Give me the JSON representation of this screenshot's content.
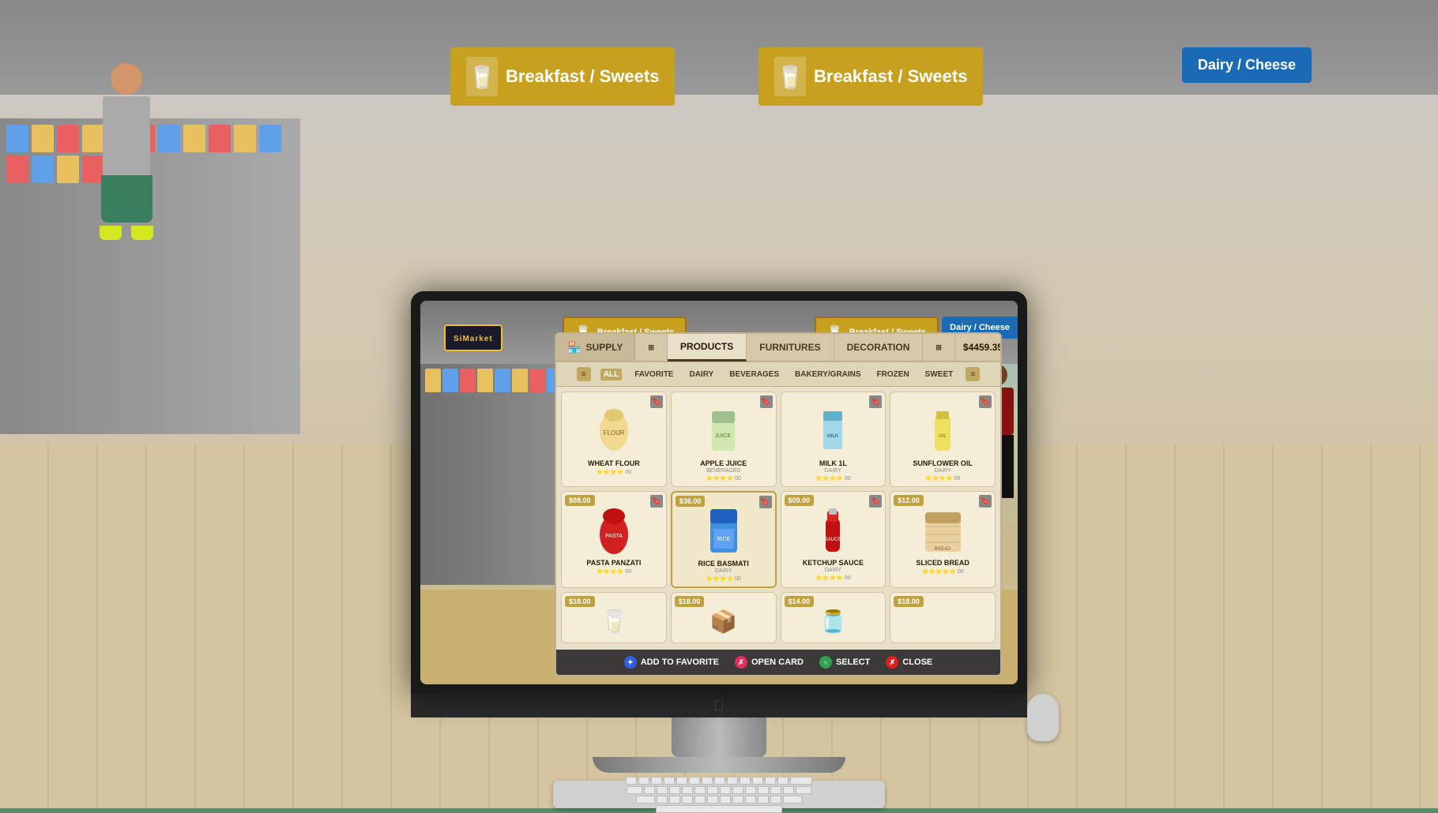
{
  "app": {
    "title": "SiMarket"
  },
  "header": {
    "supply_label": "SUPPLY",
    "nav_tabs": [
      {
        "id": "products",
        "label": "PRODUCTS",
        "active": true
      },
      {
        "id": "furnitures",
        "label": "FURNITURES",
        "active": false
      },
      {
        "id": "decoration",
        "label": "DECORATION",
        "active": false
      }
    ],
    "balance": "$4459.35"
  },
  "filters": {
    "items": [
      {
        "id": "all",
        "label": "ALL",
        "active": true
      },
      {
        "id": "favorite",
        "label": "FAVORITE",
        "active": false
      },
      {
        "id": "dairy",
        "label": "DAIRY",
        "active": false
      },
      {
        "id": "beverages",
        "label": "BEVERAGES",
        "active": false
      },
      {
        "id": "bakery_grains",
        "label": "BAKERY/GRAINS",
        "active": false
      },
      {
        "id": "frozen",
        "label": "FROZEN",
        "active": false
      },
      {
        "id": "sweet",
        "label": "SWEET",
        "active": false
      }
    ]
  },
  "products": {
    "row1": [
      {
        "id": "wheat_flour",
        "name": "WHEAT FLOUR",
        "price": "",
        "sub": "",
        "emoji": "🌾",
        "bookmarked": false
      },
      {
        "id": "apple_juice",
        "name": "APPLE JUICE",
        "price": "",
        "sub": "BEVERAGES",
        "emoji": "🍎",
        "bookmarked": false
      },
      {
        "id": "milk_1l",
        "name": "MILK 1L",
        "price": "",
        "sub": "DAIRY",
        "emoji": "🥛",
        "bookmarked": false
      },
      {
        "id": "sunflower_oil",
        "name": "SUNFLOWER OIL",
        "price": "",
        "sub": "DAIRY",
        "emoji": "🫙",
        "bookmarked": false
      }
    ],
    "row2": [
      {
        "id": "pasta_panzati",
        "name": "PASTA PANZATI",
        "price": "$08.00",
        "sub": "",
        "emoji": "🍝",
        "bookmarked": false
      },
      {
        "id": "rice_basmati",
        "name": "RICE BASMATI",
        "price": "$36.00",
        "sub": "DAIRY",
        "emoji": "🍚",
        "bookmarked": false
      },
      {
        "id": "ketchup_sauce",
        "name": "KETCHUP SAUCE",
        "price": "$09.00",
        "sub": "DAIRY",
        "emoji": "🍅",
        "bookmarked": false
      },
      {
        "id": "sliced_bread",
        "name": "SLICED BREAD",
        "price": "$12.00",
        "sub": "",
        "emoji": "🍞",
        "bookmarked": false
      }
    ],
    "row3_partial": [
      {
        "id": "item_a",
        "name": "",
        "price": "$18.00",
        "emoji": "🥛"
      },
      {
        "id": "item_b",
        "name": "",
        "price": "$18.00",
        "emoji": "📦"
      },
      {
        "id": "item_c",
        "name": "",
        "price": "$14.00",
        "emoji": "🫙"
      },
      {
        "id": "item_d",
        "name": "",
        "price": "$18.00",
        "emoji": ""
      }
    ]
  },
  "actions": {
    "add_to_favorite": "ADD TO FAVORITE",
    "open_card": "OPEN CARD",
    "select": "SELECT",
    "close": "CLOSE"
  },
  "store_signs": {
    "sign1": "Breakfast / Sweets",
    "sign2": "Breakfast / Sweets",
    "sign3": "Dairy / Cheese"
  },
  "icons": {
    "supply": "🏪",
    "cart": "🛒",
    "list": "📋",
    "filter_left": "≡",
    "filter_right": "≡"
  }
}
